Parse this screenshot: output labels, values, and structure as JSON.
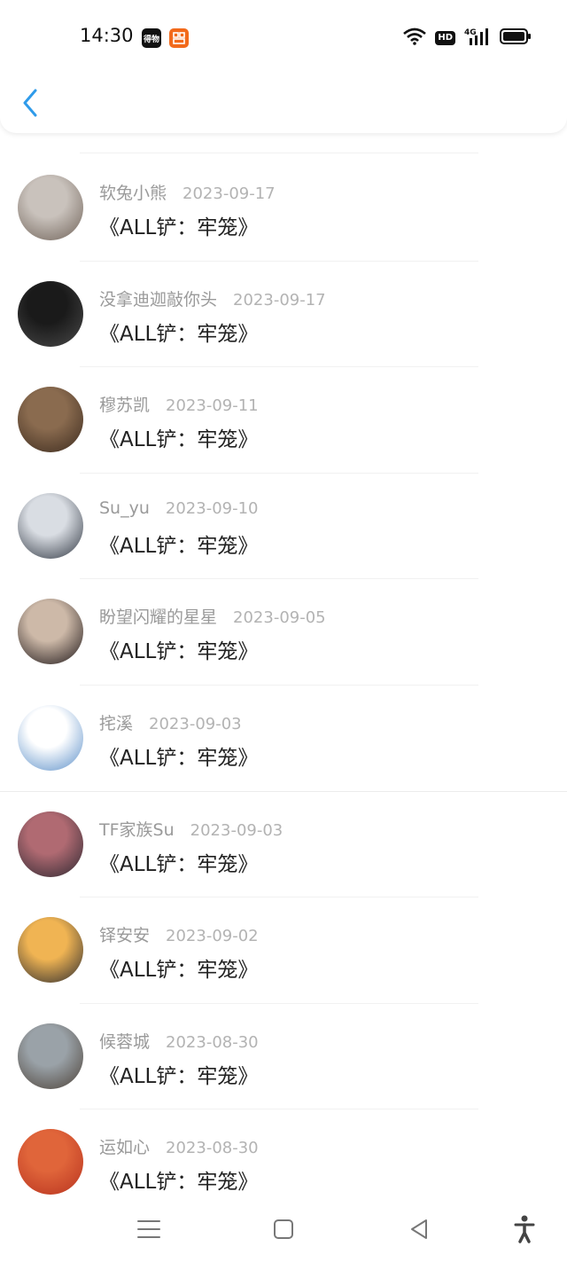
{
  "status_bar": {
    "time": "14:30",
    "badge_1": "得物",
    "badge_2": "",
    "hd": "HD",
    "network": "4G"
  },
  "items": [
    {
      "username": "软兔小熊",
      "date": "2023-09-17",
      "title": "《ALL铲：牢笼》",
      "avatar_colors": [
        "#c9c2bc",
        "#6f6258"
      ]
    },
    {
      "username": "没拿迪迦敲你头",
      "date": "2023-09-17",
      "title": "《ALL铲：牢笼》",
      "avatar_colors": [
        "#1a1a1a",
        "#4a4a4a"
      ]
    },
    {
      "username": "穆苏凯",
      "date": "2023-09-11",
      "title": "《ALL铲：牢笼》",
      "avatar_colors": [
        "#8a6b4f",
        "#3b2a1e"
      ]
    },
    {
      "username": "Su_yu",
      "date": "2023-09-10",
      "title": "《ALL铲：牢笼》",
      "avatar_colors": [
        "#d9dde3",
        "#2e3540"
      ]
    },
    {
      "username": "盼望闪耀的星星",
      "date": "2023-09-05",
      "title": "《ALL铲：牢笼》",
      "avatar_colors": [
        "#cdb9a8",
        "#1b1416"
      ]
    },
    {
      "username": "挓溪",
      "date": "2023-09-03",
      "title": "《ALL铲：牢笼》",
      "avatar_colors": [
        "#ffffff",
        "#5a8ec8"
      ]
    },
    {
      "username": "TF家族Su",
      "date": "2023-09-03",
      "title": "《ALL铲：牢笼》",
      "avatar_colors": [
        "#b06a72",
        "#2b2730"
      ]
    },
    {
      "username": "铎安安",
      "date": "2023-09-02",
      "title": "《ALL铲：牢笼》",
      "avatar_colors": [
        "#f0b453",
        "#2a2a2f"
      ]
    },
    {
      "username": "候蓉城",
      "date": "2023-08-30",
      "title": "《ALL铲：牢笼》",
      "avatar_colors": [
        "#9aa2a8",
        "#4b4036"
      ]
    },
    {
      "username": "运如心",
      "date": "2023-08-30",
      "title": "《ALL铲：牢笼》",
      "avatar_colors": [
        "#e0653a",
        "#b7321f"
      ]
    }
  ],
  "colors": {
    "accent": "#2f9bea",
    "text_primary": "#222222",
    "text_secondary": "#9a9a9a"
  }
}
